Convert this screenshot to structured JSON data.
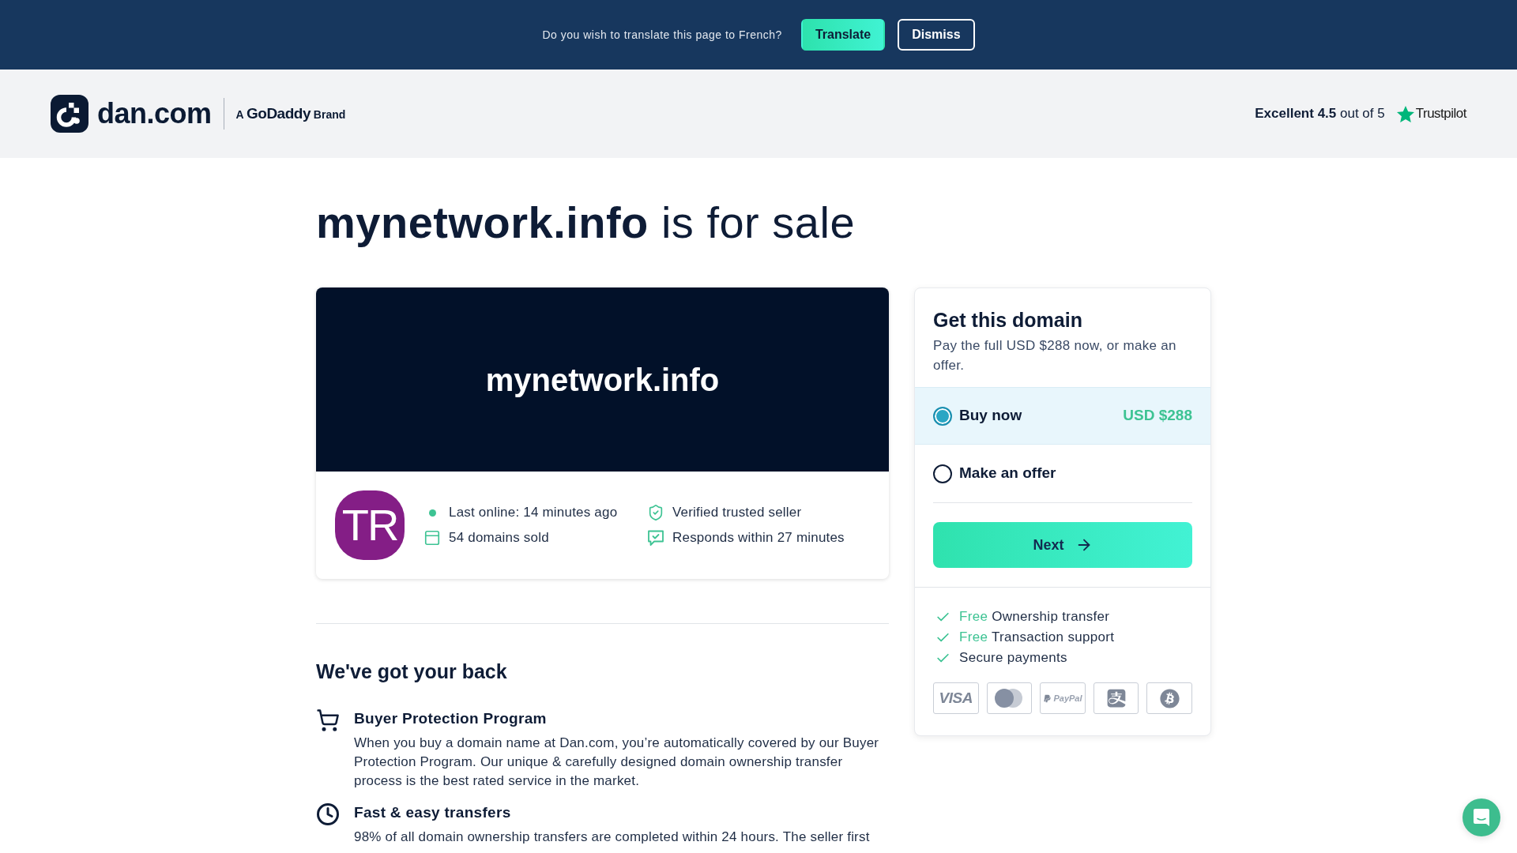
{
  "translate_bar": {
    "message": "Do you wish to translate this page to French?",
    "actions": [
      {
        "label": "Translate",
        "kind": "primary"
      },
      {
        "label": "Dismiss",
        "kind": "outline"
      }
    ]
  },
  "header": {
    "logo_text": "dan.com",
    "tagline": "A **GoDaddy** Brand",
    "rating": {
      "text": "**Excellent 4.5** out of 5",
      "provider": "Trustpilot"
    }
  },
  "headline": "**mynetwork.info** is for sale",
  "domain_card": {
    "banner": "mynetwork.info",
    "seller_initials": "TR",
    "facts": [
      {
        "kind": "online",
        "text": "Last online: 14 minutes ago"
      },
      {
        "kind": "verified",
        "text": "Verified trusted seller"
      },
      {
        "kind": "sold",
        "text": "54 domains sold"
      },
      {
        "kind": "response",
        "text": "Responds within 27 minutes"
      }
    ]
  },
  "trust_section": {
    "title": "We've got your back",
    "items": [
      {
        "kind": "protection",
        "title": "Buyer Protection Program",
        "text": "When you buy a domain name at Dan.com, you’re automatically covered by our Buyer Protection Program. Our unique & carefully designed domain ownership transfer process is the best rated service in the market."
      },
      {
        "kind": "speed",
        "title": "Fast & easy transfers",
        "text": "98% of all domain ownership transfers are completed within 24 hours. The seller first"
      }
    ]
  },
  "purchase_panel": {
    "title": "Get this domain",
    "subtitle": "Pay the full USD $288 now, or make an offer.",
    "options": [
      {
        "label": "Buy now",
        "price": "USD $288",
        "selected": true
      },
      {
        "label": "Make an offer",
        "selected": false
      }
    ],
    "next_button": "Next",
    "benefits": [
      {
        "highlight": "Free",
        "text": "Ownership transfer"
      },
      {
        "highlight": "Free",
        "text": "Transaction support"
      },
      {
        "text": "Secure payments"
      }
    ],
    "payment_methods": [
      {
        "kind": "visa",
        "label": "VISA"
      },
      {
        "kind": "mastercard"
      },
      {
        "kind": "paypal",
        "label": "PayPal"
      },
      {
        "kind": "alipay"
      },
      {
        "kind": "bitcoin"
      }
    ]
  }
}
